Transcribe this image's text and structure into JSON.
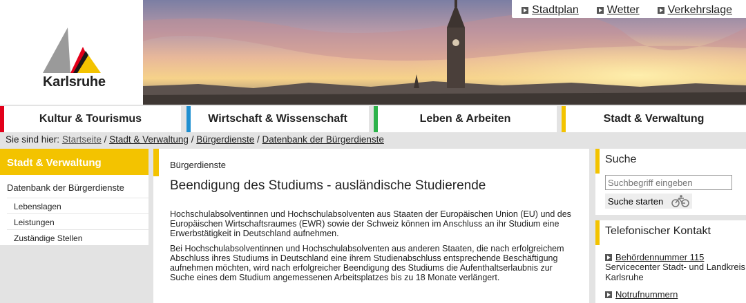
{
  "logo": {
    "text": "Karlsruhe"
  },
  "top_links": [
    "Stadtplan",
    "Wetter",
    "Verkehrslage"
  ],
  "nav": [
    {
      "label": "Kultur & Tourismus",
      "color": "#e2001a"
    },
    {
      "label": "Wirtschaft & Wissenschaft",
      "color": "#1f8fd0"
    },
    {
      "label": "Leben & Arbeiten",
      "color": "#2db34a"
    },
    {
      "label": "Stadt & Verwaltung",
      "color": "#f3c300"
    }
  ],
  "breadcrumb": {
    "prefix": "Sie sind hier:",
    "items": [
      "Startseite",
      "Stadt & Verwaltung",
      "Bürgerdienste",
      "Datenbank der Bürgerdienste"
    ]
  },
  "left_nav": {
    "header": "Stadt & Verwaltung",
    "title": "Datenbank der Bürgerdienste",
    "items": [
      "Lebenslagen",
      "Leistungen",
      "Zuständige Stellen"
    ]
  },
  "main": {
    "kicker": "Bürgerdienste",
    "title": "Beendigung des Studiums - ausländische Studierende",
    "paragraphs": [
      "Hochschulabsolventinnen und Hochschulabsolventen aus Staaten der Europäischen Union (EU) und des Europäischen Wirtschaftsraumes (EWR) sowie der Schweiz können im Anschluss an ihr Studium eine Erwerbstätigkeit in Deutschland aufnehmen.",
      "Bei Hochschulabsolventinnen und Hochschulabsolventen aus anderen Staaten, die nach erfolgreichem Abschluss ihres Studiums in Deutschland eine ihrem Studienabschluss entsprechende Beschäftigung aufnehmen möchten, wird nach erfolgreicher Beendigung des Studiums die Aufenthaltserlaubnis zur Suche eines dem Studium angemessenen Arbeitsplatzes bis zu 18 Monate verlängert."
    ]
  },
  "search": {
    "heading": "Suche",
    "placeholder": "Suchbegriff eingeben",
    "button": "Suche starten"
  },
  "phone": {
    "heading": "Telefonischer Kontakt",
    "link1": "Behördennummer 115",
    "desc": "Servicecenter Stadt- und Landkreis Karlsruhe",
    "link2": "Notrufnummern"
  }
}
